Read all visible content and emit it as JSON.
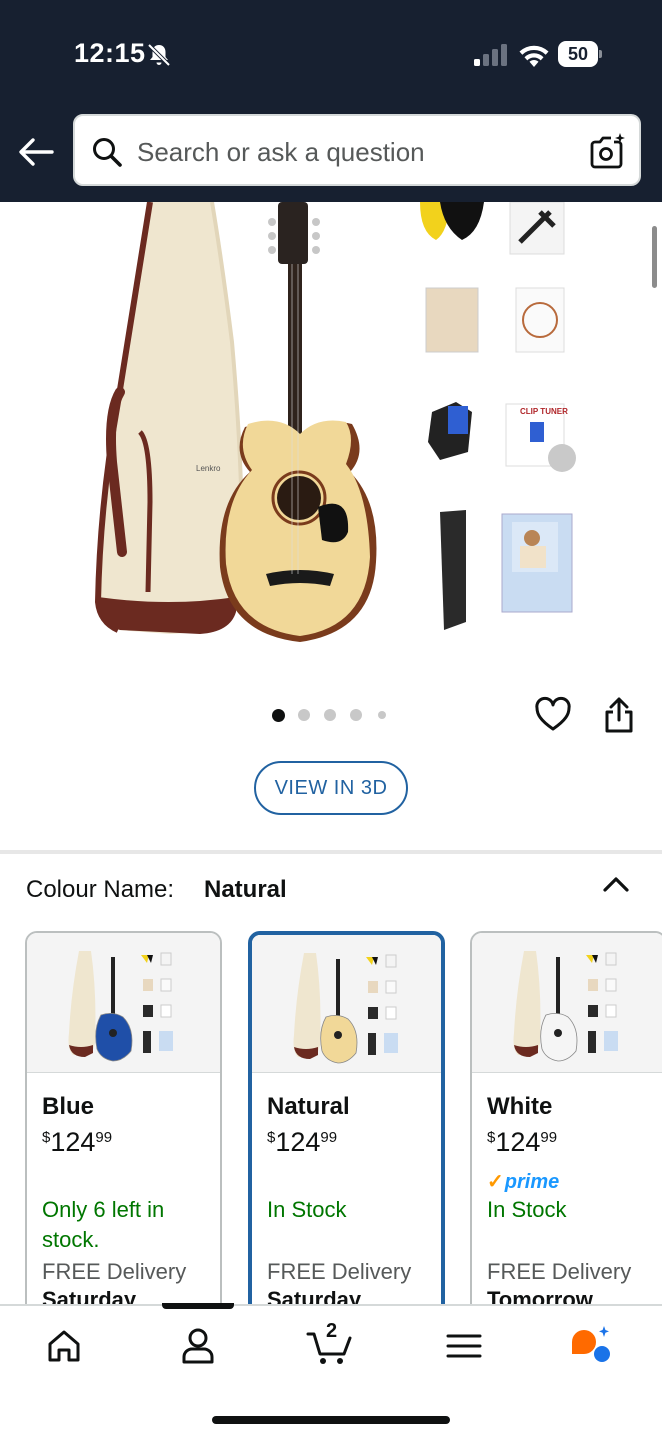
{
  "status_bar": {
    "time": "12:15",
    "battery": "50"
  },
  "header": {
    "search_placeholder": "Search or ask a question",
    "background_color": "#172030"
  },
  "product_image": {
    "brand_text": "Lenkro",
    "carousel_total": 5,
    "carousel_active": 0
  },
  "view_3d_label": "VIEW IN 3D",
  "colour": {
    "label": "Colour Name:",
    "value": "Natural"
  },
  "variants": [
    {
      "name": "Blue",
      "price_symbol": "$",
      "price_whole": "124",
      "price_fraction": "99",
      "prime": "",
      "stock": "Only 6 left in stock.",
      "delivery": "FREE Delivery",
      "delivery_day": "Saturday",
      "selected": false,
      "guitar_color": "#1f4fa8"
    },
    {
      "name": "Natural",
      "price_symbol": "$",
      "price_whole": "124",
      "price_fraction": "99",
      "prime": "",
      "stock": "In Stock",
      "delivery": "FREE Delivery",
      "delivery_day": "Saturday",
      "selected": true,
      "guitar_color": "#f1d898"
    },
    {
      "name": "White",
      "price_symbol": "$",
      "price_whole": "124",
      "price_fraction": "99",
      "prime": "prime",
      "stock": "In Stock",
      "delivery": "FREE Delivery",
      "delivery_day": "Tomorrow",
      "selected": false,
      "guitar_color": "#f5f5f5"
    }
  ],
  "bottom_nav": {
    "cart_count": "2",
    "items": [
      "home-icon",
      "account-icon",
      "cart-icon",
      "menu-icon",
      "rufus-ai-icon"
    ]
  },
  "colors": {
    "link_blue": "#2162a1",
    "in_stock_green": "#007600",
    "prime_blue": "#1a98ff",
    "prime_check": "#ff9900"
  }
}
